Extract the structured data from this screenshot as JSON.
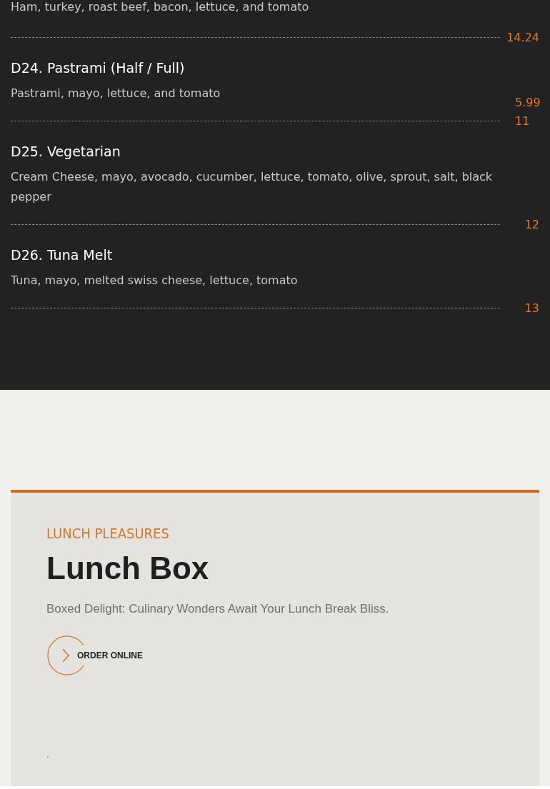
{
  "menu_items": [
    {
      "description": "Ham, turkey, roast beef, bacon, lettuce, and tomato",
      "prices": [
        "14.24"
      ]
    },
    {
      "title": "D24. Pastrami (Half / Full)",
      "description": "Pastrami, mayo, lettuce, and tomato",
      "prices": [
        "5.99",
        "11"
      ]
    },
    {
      "title": "D25. Vegetarian",
      "description": "Cream Cheese, mayo, avocado, cucumber, lettuce, tomato, olive, sprout, salt, black pepper",
      "prices": [
        "12"
      ]
    },
    {
      "title": "D26. Tuna Melt",
      "description": "Tuna, mayo, melted swiss cheese, lettuce, tomato",
      "prices": [
        "13"
      ]
    }
  ],
  "promo": {
    "eyebrow": "LUNCH PLEASURES",
    "heading": "Lunch Box",
    "subtitle": "Boxed Delight: Culinary Wonders Await Your Lunch Break Bliss.",
    "button": "ORDER ONLINE",
    "footnote": "."
  }
}
